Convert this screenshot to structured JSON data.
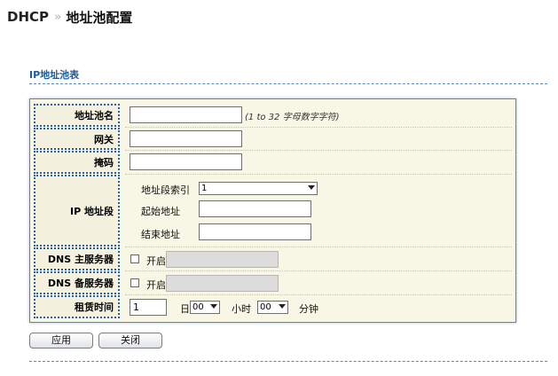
{
  "breadcrumb": {
    "root": "DHCP",
    "separator": "»",
    "current": "地址池配置"
  },
  "section": {
    "title": "IP地址池表"
  },
  "form": {
    "pool_name": {
      "label": "地址池名",
      "value": "",
      "hint": "(1 to 32 字母数字字符)"
    },
    "gateway": {
      "label": "网关",
      "value": ""
    },
    "mask": {
      "label": "掩码",
      "value": ""
    },
    "ip_range": {
      "label": "IP 地址段",
      "index_label": "地址段索引",
      "index_value": "1",
      "start_label": "起始地址",
      "start_value": "",
      "end_label": "结束地址",
      "end_value": ""
    },
    "dns_primary": {
      "label": "DNS 主服务器",
      "enable_label": "开启",
      "checked": false,
      "value": ""
    },
    "dns_secondary": {
      "label": "DNS 备服务器",
      "enable_label": "开启",
      "checked": false,
      "value": ""
    },
    "lease": {
      "label": "租赁时间",
      "days_value": "1",
      "days_unit": "日",
      "hours_value": "00",
      "hours_unit": "小时",
      "minutes_value": "00",
      "minutes_unit": "分钟"
    }
  },
  "buttons": {
    "apply": "应用",
    "close": "关闭"
  },
  "colors": {
    "panel_bg": "#f8f6e4",
    "label_border": "#2560b0",
    "section_title": "#1d5b9a"
  }
}
